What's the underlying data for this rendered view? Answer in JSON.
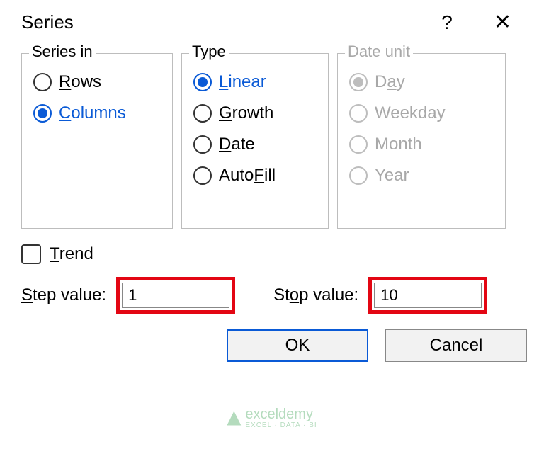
{
  "dialog": {
    "title": "Series",
    "help_tooltip": "?",
    "close_tooltip": "✕"
  },
  "groups": {
    "series_in": {
      "legend": "Series in",
      "rows": "Rows",
      "columns": "Columns",
      "selected": "columns"
    },
    "type": {
      "legend": "Type",
      "linear": "Linear",
      "growth": "Growth",
      "date": "Date",
      "autofill": "AutoFill",
      "selected": "linear"
    },
    "date_unit": {
      "legend": "Date unit",
      "day": "Day",
      "weekday": "Weekday",
      "month": "Month",
      "year": "Year",
      "selected": "day",
      "enabled": false
    }
  },
  "trend": {
    "label": "Trend",
    "checked": false
  },
  "step": {
    "label": "Step value:",
    "value": "1"
  },
  "stop": {
    "label": "Stop value:",
    "value": "10"
  },
  "buttons": {
    "ok": "OK",
    "cancel": "Cancel"
  },
  "watermark": {
    "text": "exceldemy",
    "sub": "EXCEL · DATA · BI"
  },
  "highlight_color": "#e30613",
  "accent_color": "#0a5ad6"
}
